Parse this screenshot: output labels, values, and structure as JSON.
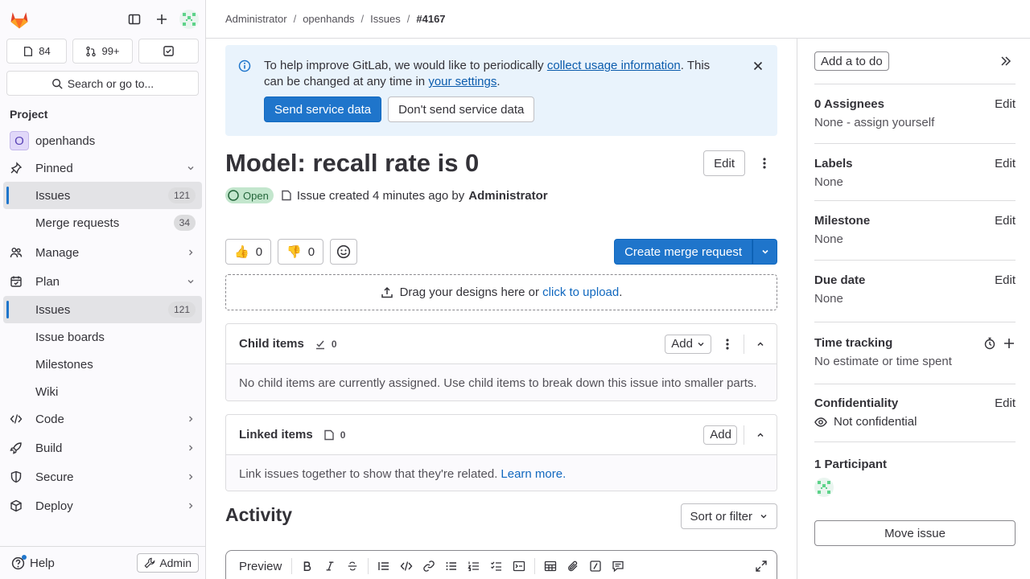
{
  "sidebar": {
    "counts": {
      "issues": "84",
      "merge_requests": "99+"
    },
    "search_label": "Search or go to...",
    "section_title": "Project",
    "project": {
      "initial": "O",
      "name": "openhands"
    },
    "pinned": {
      "label": "Pinned",
      "issues": {
        "label": "Issues",
        "count": "121"
      },
      "merge_requests": {
        "label": "Merge requests",
        "count": "34"
      }
    },
    "manage": "Manage",
    "plan": {
      "label": "Plan",
      "issues": {
        "label": "Issues",
        "count": "121"
      },
      "issue_boards": "Issue boards",
      "milestones": "Milestones",
      "wiki": "Wiki"
    },
    "code": "Code",
    "build": "Build",
    "secure": "Secure",
    "deploy": "Deploy",
    "help": "Help",
    "admin": "Admin"
  },
  "breadcrumb": [
    "Administrator",
    "openhands",
    "Issues",
    "#4167"
  ],
  "alert": {
    "text1": "To help improve GitLab, we would like to periodically ",
    "link1": "collect usage information",
    "text2": ". This can be changed at any time in ",
    "link2": "your settings",
    "text3": ".",
    "send": "Send service data",
    "dont_send": "Don't send service data"
  },
  "issue": {
    "title": "Model: recall rate is 0",
    "edit": "Edit",
    "status": "Open",
    "created": "Issue created 4 minutes ago by",
    "author": "Administrator",
    "thumbs_up": "0",
    "thumbs_down": "0",
    "create_mr": "Create merge request",
    "drop_text": "Drag your designs here or ",
    "drop_link": "click to upload",
    "drop_end": "."
  },
  "child_items": {
    "title": "Child items",
    "count": "0",
    "add": "Add",
    "empty": "No child items are currently assigned. Use child items to break down this issue into smaller parts."
  },
  "linked_items": {
    "title": "Linked items",
    "count": "0",
    "add": "Add",
    "empty": "Link issues together to show that they're related.",
    "learn_more": "Learn more."
  },
  "activity": {
    "title": "Activity",
    "sort": "Sort or filter"
  },
  "editor": {
    "preview": "Preview"
  },
  "right_sidebar": {
    "todo": "Add a to do",
    "assignees": {
      "title": "0 Assignees",
      "edit": "Edit",
      "value": "None - assign yourself"
    },
    "labels": {
      "title": "Labels",
      "edit": "Edit",
      "value": "None"
    },
    "milestone": {
      "title": "Milestone",
      "edit": "Edit",
      "value": "None"
    },
    "due_date": {
      "title": "Due date",
      "edit": "Edit",
      "value": "None"
    },
    "time_tracking": {
      "title": "Time tracking",
      "value": "No estimate or time spent"
    },
    "confidentiality": {
      "title": "Confidentiality",
      "edit": "Edit",
      "value": "Not confidential"
    },
    "participants": {
      "title": "1 Participant"
    },
    "move": "Move issue"
  },
  "colors": {
    "accent": "#1f75cb",
    "status_open_bg": "#c3e6cd",
    "alert_bg": "#e9f3fc"
  }
}
